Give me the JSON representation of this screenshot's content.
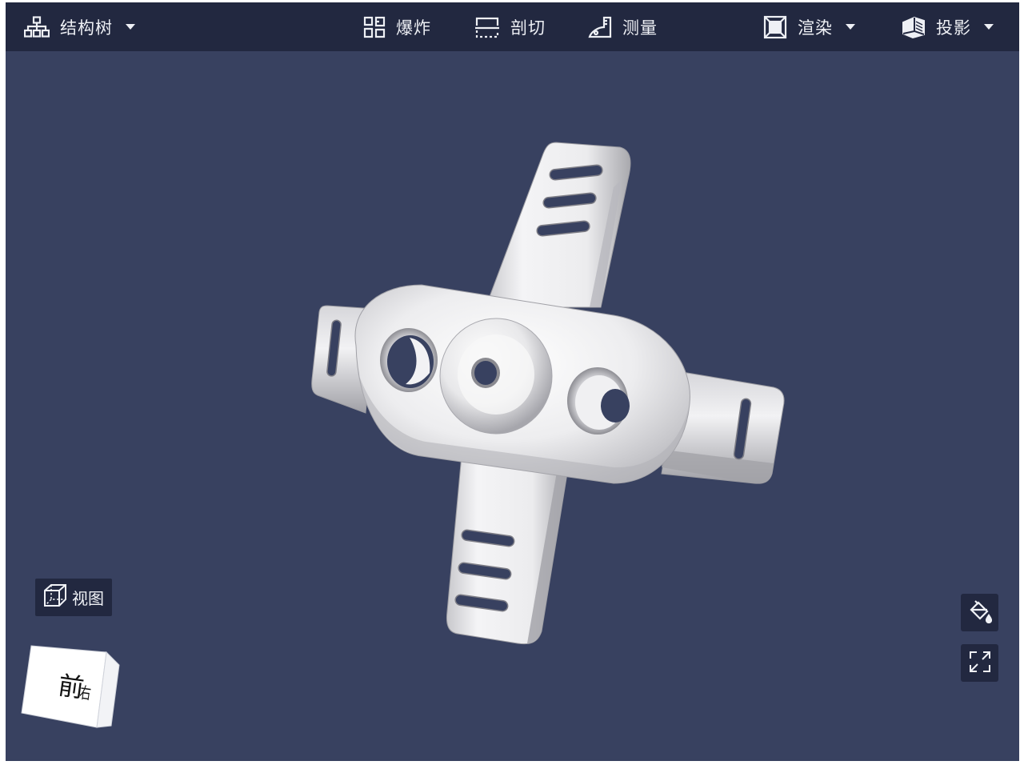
{
  "toolbar": {
    "structure_tree": "结构树",
    "explode": "爆炸",
    "section": "剖切",
    "measure": "测量",
    "render": "渲染",
    "projection": "投影"
  },
  "view_button": "视图",
  "nav_cube": {
    "front": "前",
    "right": "右"
  },
  "icons": {
    "structure_tree": "tree-hierarchy-icon",
    "explode": "explode-icon",
    "section": "section-cut-icon",
    "measure": "measure-icon",
    "render": "render-cube-icon",
    "projection": "projection-box-icon",
    "view": "wireframe-cube-icon",
    "paint": "paint-bucket-icon",
    "fullscreen": "fullscreen-icon"
  },
  "colors": {
    "toolbar_bg": "#222840",
    "viewport_bg": "#384160",
    "model": "#e6e6e8"
  }
}
